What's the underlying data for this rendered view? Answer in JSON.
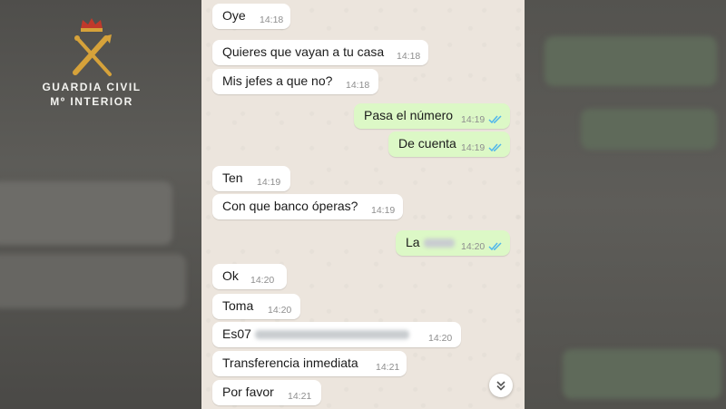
{
  "logo": {
    "line1": "GUARDIA CIVIL",
    "line2": "Mº INTERIOR"
  },
  "messages": [
    {
      "dir": "in",
      "text": "Oye",
      "time": "14:18"
    },
    {
      "dir": "in",
      "text": "Quieres que vayan a tu casa",
      "time": "14:18"
    },
    {
      "dir": "in",
      "text": "Mis jefes a que no?",
      "time": "14:18"
    },
    {
      "dir": "out",
      "text": "Pasa el número",
      "time": "14:19",
      "status": "read"
    },
    {
      "dir": "out",
      "text": "De cuenta",
      "time": "14:19",
      "status": "read"
    },
    {
      "dir": "in",
      "text": "Ten",
      "time": "14:19"
    },
    {
      "dir": "in",
      "text": "Con que banco óperas?",
      "time": "14:19"
    },
    {
      "dir": "out",
      "text": "La",
      "time": "14:20",
      "status": "read",
      "redacted": true
    },
    {
      "dir": "in",
      "text": "Ok",
      "time": "14:20"
    },
    {
      "dir": "in",
      "text": "Toma",
      "time": "14:20"
    },
    {
      "dir": "in",
      "text": "Es07",
      "time": "14:20",
      "redacted": true
    },
    {
      "dir": "in",
      "text": "Transferencia inmediata",
      "time": "14:21"
    },
    {
      "dir": "in",
      "text": "Por favor",
      "time": "14:21"
    }
  ],
  "icons": {
    "read_receipt": "double-check-icon",
    "scroll_down": "chevron-double-down-icon",
    "emblem": "guardia-civil-emblem-icon"
  },
  "colors": {
    "incoming_bubble": "#ffffff",
    "outgoing_bubble": "#dcf8c6",
    "chat_background": "#ece5dd",
    "read_ticks": "#4fb6ec",
    "emblem_gold": "#d6a23a",
    "emblem_red": "#c0392b"
  }
}
